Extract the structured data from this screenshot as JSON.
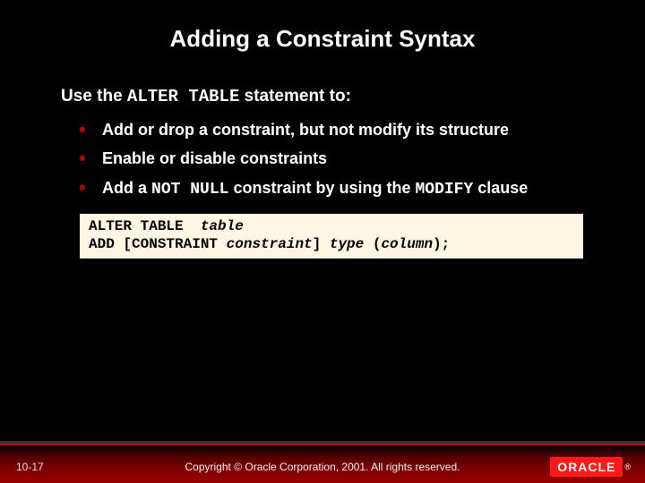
{
  "title": "Adding a Constraint Syntax",
  "intro": {
    "prefix": "Use the ",
    "code": "ALTER TABLE",
    "suffix": " statement to:"
  },
  "bullets": [
    {
      "text": "Add or drop a constraint, but not modify its structure"
    },
    {
      "text": "Enable or disable constraints"
    },
    {
      "pre": "Add a ",
      "code1": "NOT NULL",
      "mid": " constraint by using the ",
      "code2": "MODIFY",
      "post": " clause"
    }
  ],
  "code": {
    "line1_kw": "ALTER TABLE  ",
    "line1_em": "table",
    "line2_kw1": "ADD [CONSTRAINT ",
    "line2_em1": "constraint",
    "line2_kw2": "] ",
    "line2_em2": "type",
    "line2_kw3": " (",
    "line2_em3": "column",
    "line2_kw4": ");"
  },
  "footer": {
    "slideNumber": "10-17",
    "copyright": "Copyright © Oracle Corporation, 2001. All rights reserved.",
    "logoText": "ORACLE",
    "logoReg": "®"
  }
}
